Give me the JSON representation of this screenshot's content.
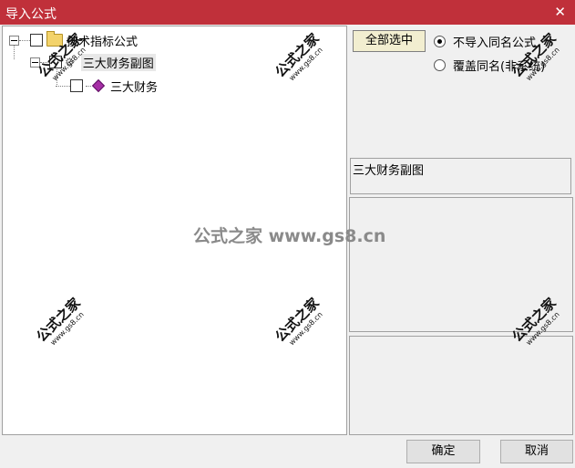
{
  "window": {
    "title": "导入公式",
    "close_icon": "close-icon"
  },
  "tree": {
    "root": {
      "label": "技术指标公式",
      "icon": "folder-icon"
    },
    "child": {
      "label": "三大财务副图",
      "icon": "gear-icon"
    },
    "leaf": {
      "label": "三大财务",
      "icon": "gem-icon"
    }
  },
  "options": {
    "select_all": "全部选中",
    "radio_skip": "不导入同名公式",
    "radio_overwrite": "覆盖同名(非系统)",
    "selected_radio": "radio_skip"
  },
  "details": {
    "formula_name": "三大财务副图"
  },
  "buttons": {
    "ok": "确定",
    "cancel": "取消"
  },
  "watermark": {
    "big": "公式之家",
    "small": "www.gs8.cn",
    "center": "公式之家 www.gs8.cn"
  },
  "colors": {
    "titlebar": "#c0303a"
  }
}
